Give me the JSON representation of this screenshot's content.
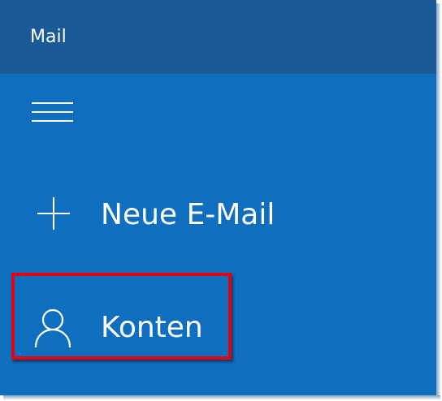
{
  "app": {
    "title": "Mail"
  },
  "nav": {
    "menu_icon": "hamburger-menu-icon",
    "items": [
      {
        "label": "Neue E-Mail",
        "icon": "plus-icon"
      },
      {
        "label": "Konten",
        "icon": "person-icon"
      }
    ]
  },
  "colors": {
    "titlebar": "#195a97",
    "pane": "#106ebe",
    "text": "#ffffff",
    "highlight": "#e3000f"
  }
}
